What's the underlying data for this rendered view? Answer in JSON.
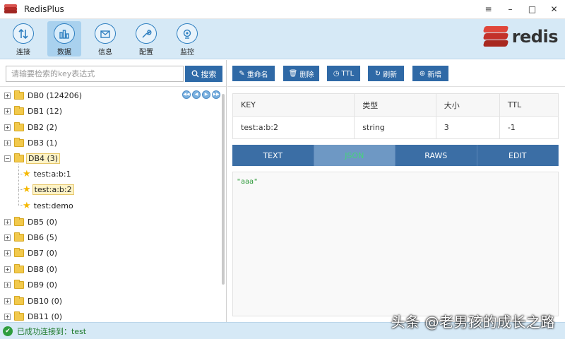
{
  "window": {
    "title": "RedisPlus",
    "controls": [
      "≡",
      "–",
      "□",
      "✕"
    ]
  },
  "toolbar": {
    "items": [
      {
        "label": "连接",
        "icon": "swap-arrows-icon"
      },
      {
        "label": "数据",
        "icon": "bar-chart-icon"
      },
      {
        "label": "信息",
        "icon": "mail-icon"
      },
      {
        "label": "配置",
        "icon": "wrench-icon"
      },
      {
        "label": "监控",
        "icon": "monitor-icon"
      }
    ],
    "brand": "redis"
  },
  "search": {
    "placeholder": "请输要检索的key表达式",
    "button": "搜索"
  },
  "tree": {
    "pager": [
      "◀◀",
      "◀",
      "▶",
      "▶▶"
    ],
    "nodes": [
      {
        "label": "DB0 (124206)"
      },
      {
        "label": "DB1 (12)"
      },
      {
        "label": "DB2 (2)"
      },
      {
        "label": "DB3 (1)"
      },
      {
        "label": "DB4 (3)"
      },
      {
        "label": "test:a:b:1"
      },
      {
        "label": "test:a:b:2"
      },
      {
        "label": "test:demo"
      },
      {
        "label": "DB5 (0)"
      },
      {
        "label": "DB6 (5)"
      },
      {
        "label": "DB7 (0)"
      },
      {
        "label": "DB8 (0)"
      },
      {
        "label": "DB9 (0)"
      },
      {
        "label": "DB10 (0)"
      },
      {
        "label": "DB11 (0)"
      }
    ]
  },
  "actions": [
    "重命名",
    "删除",
    "TTL",
    "刷新",
    "新增"
  ],
  "keyinfo": {
    "headers": [
      "KEY",
      "类型",
      "大小",
      "TTL"
    ],
    "values": [
      "test:a:b:2",
      "string",
      "3",
      "-1"
    ]
  },
  "tabs": [
    "TEXT",
    "JSON",
    "RAWS",
    "EDIT"
  ],
  "editor": {
    "content": "\"aaa\""
  },
  "status": {
    "text": "已成功连接到：test"
  },
  "watermark": "头条 @老男孩的成长之路"
}
